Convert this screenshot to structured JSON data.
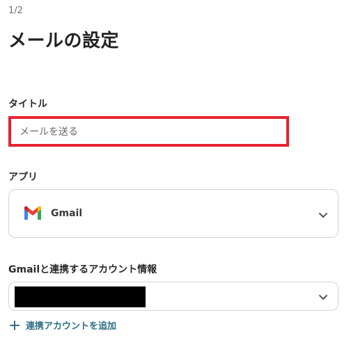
{
  "step": "1/2",
  "page_title": "メールの設定",
  "fields": {
    "title_label": "タイトル",
    "title_value": "メールを送る",
    "app_label": "アプリ",
    "app_selected": "Gmail",
    "account_label": "Gmailと連携するアカウント情報",
    "add_account_label": "連携アカウントを追加"
  },
  "icons": {
    "app": "gmail-icon",
    "dropdown": "chevron-down-icon",
    "add": "plus-icon"
  },
  "colors": {
    "highlight_border": "#e5232f",
    "link": "#2f6f88",
    "redaction": "#000000"
  }
}
